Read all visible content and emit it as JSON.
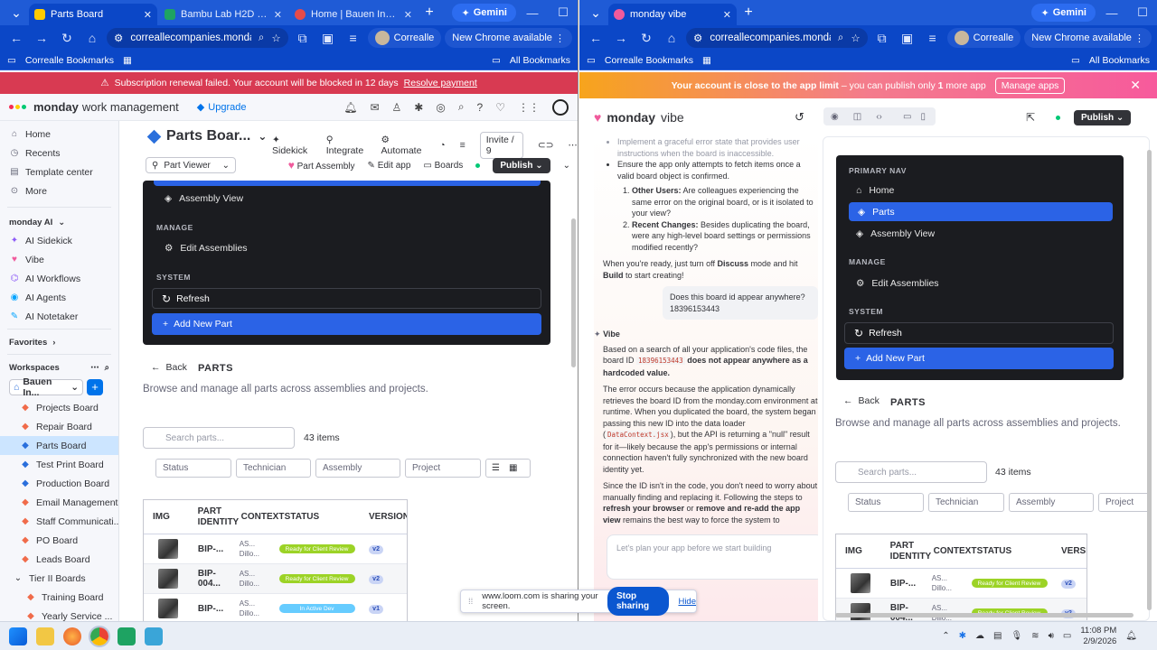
{
  "left_window": {
    "tabs": [
      {
        "title": "Parts Board",
        "active": true
      },
      {
        "title": "Bambu Lab H2D Pro | Bam",
        "active": false
      },
      {
        "title": "Home | Bauen Innovation",
        "active": false
      }
    ],
    "gemini": "Gemini",
    "url": "correallecompanies.monday.com/boards...",
    "profile": "Correalle",
    "new_chrome": "New Chrome available",
    "bookmarks": {
      "left": "Correalle Bookmarks",
      "right": "All Bookmarks"
    },
    "alert": {
      "text": "Subscription renewal failed. Your account will be blocked in 12 days",
      "link": "Resolve payment"
    },
    "topbar": {
      "brand": "monday",
      "brand_suffix": "work management",
      "upgrade": "Upgrade"
    },
    "sidebar": {
      "top_items": [
        "Home",
        "Recents",
        "Template center",
        "More"
      ],
      "ai_header": "monday AI",
      "ai_items": [
        "AI Sidekick",
        "Vibe",
        "AI Workflows",
        "AI Agents",
        "AI Notetaker"
      ],
      "favorites": "Favorites",
      "workspaces": "Workspaces",
      "workspace_name": "Bauen In...",
      "boards": [
        "Projects Board",
        "Repair Board",
        "Parts Board",
        "Test Print Board",
        "Production Board",
        "Email Management",
        "Staff Communicati...",
        "PO Board",
        "Leads Board",
        "Tier II Boards",
        "Training Board",
        "Yearly Service ..."
      ]
    },
    "board": {
      "title": "Parts Boar...",
      "actions": [
        "Sidekick",
        "Integrate",
        "Automate"
      ],
      "invite": "Invite / 9",
      "view": "Part Viewer",
      "app_name": "Part Assembly",
      "edit_app": "Edit app",
      "boards": "Boards",
      "publish": "Publish"
    }
  },
  "app_nav": {
    "primary_header": "PRIMARY NAV",
    "items": [
      "Home",
      "Parts",
      "Assembly View"
    ],
    "manage_header": "MANAGE",
    "manage_item": "Edit Assemblies",
    "system_header": "SYSTEM",
    "refresh": "Refresh",
    "add_new": "Add New Part"
  },
  "parts_page": {
    "back": "Back",
    "title": "PARTS",
    "subtitle": "Browse and manage all parts across assemblies and projects.",
    "search_placeholder": "Search parts...",
    "count": "43 items",
    "filters": [
      "Status",
      "Technician",
      "Assembly",
      "Project"
    ],
    "columns": [
      "IMG",
      "PART IDENTITY",
      "CONTEXT",
      "STATUS",
      "VERSION"
    ],
    "rows": [
      {
        "id": "BIP-...",
        "ctx1": "AS...",
        "ctx2": "Dillo...",
        "status": "Ready for Client Review",
        "status_color": "#9cd326",
        "version": "v2"
      },
      {
        "id": "BIP-004...",
        "ctx1": "AS...",
        "ctx2": "Dillo...",
        "status": "Ready for Client Review",
        "status_color": "#9cd326",
        "version": "v2"
      },
      {
        "id": "BIP-...",
        "ctx1": "AS...",
        "ctx2": "Dillo...",
        "status": "In Active Dev",
        "status_color": "#66ccff",
        "version": "v1"
      }
    ]
  },
  "right_window": {
    "tab": "monday vibe",
    "gemini": "Gemini",
    "url": "correallecompanies.monday.com/vibe/ap...",
    "profile": "Correalle",
    "new_chrome": "New Chrome available",
    "bookmarks": {
      "left": "Correalle Bookmarks",
      "right": "All Bookmarks"
    },
    "banner": {
      "bold": "Your account is close to the app limit",
      "rest": " – you can publish only ",
      "num": "1",
      "tail": " more app",
      "button": "Manage apps"
    },
    "brand": "monday",
    "brand_suffix": "vibe",
    "publish": "Publish",
    "chat": {
      "l1": "Implement a graceful error state that provides user instructions when the board is inaccessible.",
      "l2": "Ensure the app only attempts to fetch items once a valid board object is confirmed.",
      "q1_label": "Other Users:",
      "q1": " Are colleagues experiencing the same error on the original board, or is it isolated to your view?",
      "q2_label": "Recent Changes:",
      "q2": " Besides duplicating the board, were any high-level board settings or permissions modified recently?",
      "ready_a": "When you're ready, just turn off ",
      "ready_discuss": "Discuss",
      "ready_b": " mode and hit ",
      "ready_build": "Build",
      "ready_c": " to start creating!",
      "user_msg": "Does this board id appear anywhere? 18396153443",
      "vibe": "Vibe",
      "r1a": "Based on a search of all your application's code files, the board ID ",
      "r1code": "18396153443",
      "r1b": " does not appear anywhere as a hardcoded value.",
      "r2a": "The error occurs because the application dynamically retrieves the board ID from the monday.com environment at runtime. When you duplicated the board, the system began passing this new ID into the data loader (",
      "r2code": "DataContext.jsx",
      "r2b": "), but the API is returning a \"null\" result for it—likely because the app's permissions or internal connection haven't fully synchronized with the new board identity yet.",
      "r3a": "Since the ID isn't in the code, you don't need to worry about manually finding and replacing it. Following the steps to ",
      "r3b": "refresh your browser",
      "r3c": " or ",
      "r3d": "remove and re-add the app view",
      "r3e": " remains the best way to force the system to",
      "composer": "Let's plan your app before we start building"
    }
  },
  "loom": {
    "text": "www.loom.com is sharing your screen.",
    "stop": "Stop sharing",
    "hide": "Hide"
  },
  "taskbar": {
    "time": "11:08 PM",
    "date": "2/9/2026"
  }
}
